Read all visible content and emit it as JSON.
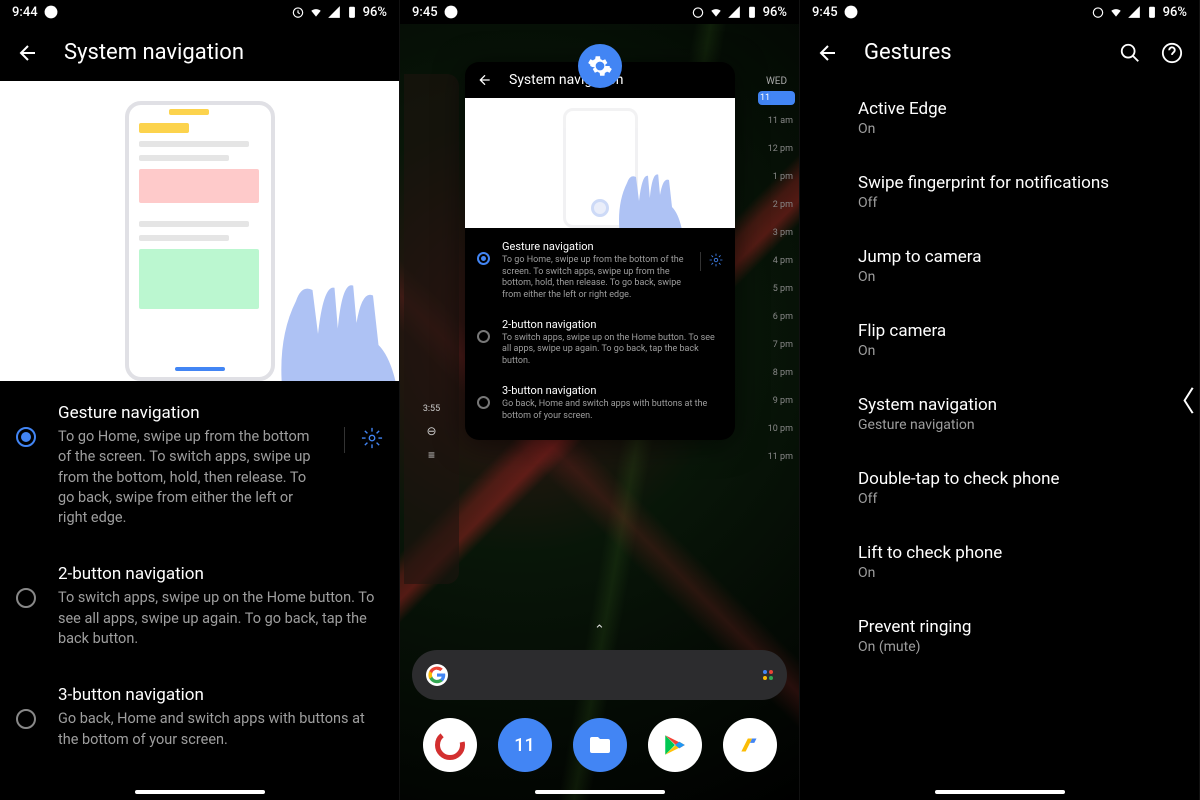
{
  "status": {
    "time1": "9:44",
    "time2": "9:45",
    "time3": "9:45",
    "battery": "96%"
  },
  "screen1": {
    "title": "System navigation",
    "options": [
      {
        "title": "Gesture navigation",
        "desc": "To go Home, swipe up from the bottom of the screen. To switch apps, swipe up from the bottom, hold, then release. To go back, swipe from either the left or right edge.",
        "selected": true,
        "has_gear": true
      },
      {
        "title": "2-button navigation",
        "desc": "To switch apps, swipe up on the Home button. To see all apps, swipe up again. To go back, tap the back button.",
        "selected": false,
        "has_gear": false
      },
      {
        "title": "3-button navigation",
        "desc": "Go back, Home and switch apps with buttons at the bottom of your screen.",
        "selected": false,
        "has_gear": false
      }
    ]
  },
  "screen2": {
    "mini_title": "System navigation",
    "options": [
      {
        "title": "Gesture navigation",
        "desc": "To go Home, swipe up from the bottom of the screen. To switch apps, swipe up from the bottom, hold, then release. To go back, swipe from either the left or right edge.",
        "selected": true,
        "has_gear": true
      },
      {
        "title": "2-button navigation",
        "desc": "To switch apps, swipe up on the Home button. To see all apps, swipe up again. To go back, tap the back button.",
        "selected": false
      },
      {
        "title": "3-button navigation",
        "desc": "Go back, Home and switch apps with buttons at the bottom of your screen.",
        "selected": false
      }
    ],
    "calendar": {
      "day_label": "WED",
      "date": "11",
      "hours": [
        "11 am",
        "12 pm",
        "1 pm",
        "2 pm",
        "3 pm",
        "4 pm",
        "5 pm",
        "6 pm",
        "7 pm",
        "8 pm",
        "9 pm",
        "10 pm",
        "11 pm"
      ]
    },
    "music_time": "3:55",
    "dock_icons": [
      "ccleaner",
      "calendar",
      "files",
      "play-store",
      "adsense"
    ],
    "calendar_icon_date": "11"
  },
  "screen3": {
    "title": "Gestures",
    "items": [
      {
        "title": "Active Edge",
        "sub": "On"
      },
      {
        "title": "Swipe fingerprint for notifications",
        "sub": "Off"
      },
      {
        "title": "Jump to camera",
        "sub": "On"
      },
      {
        "title": "Flip camera",
        "sub": "On"
      },
      {
        "title": "System navigation",
        "sub": "Gesture navigation"
      },
      {
        "title": "Double-tap to check phone",
        "sub": "Off"
      },
      {
        "title": "Lift to check phone",
        "sub": "On"
      },
      {
        "title": "Prevent ringing",
        "sub": "On (mute)"
      }
    ]
  }
}
